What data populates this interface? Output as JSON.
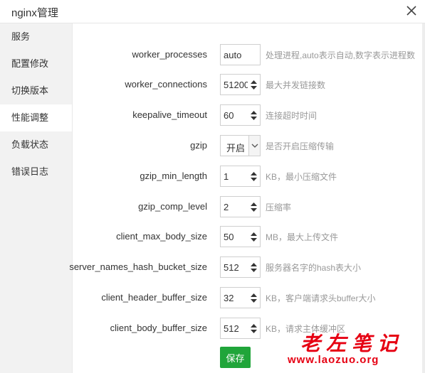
{
  "window": {
    "title": "nginx管理",
    "close_icon": "close-icon"
  },
  "sidebar": {
    "items": [
      {
        "label": "服务"
      },
      {
        "label": "配置修改"
      },
      {
        "label": "切换版本"
      },
      {
        "label": "性能调整",
        "active": true
      },
      {
        "label": "负载状态"
      },
      {
        "label": "错误日志"
      }
    ]
  },
  "settings": [
    {
      "name": "worker_processes",
      "value": "auto",
      "type": "text",
      "hint": "处理进程,auto表示自动,数字表示进程数"
    },
    {
      "name": "worker_connections",
      "value": "51200",
      "type": "number",
      "hint": "最大并发链接数"
    },
    {
      "name": "keepalive_timeout",
      "value": "60",
      "type": "number",
      "hint": "连接超时时间"
    },
    {
      "name": "gzip",
      "value": "开启",
      "type": "select",
      "hint": "是否开启压缩传输"
    },
    {
      "name": "gzip_min_length",
      "value": "1",
      "type": "number",
      "hint": "KB，最小压缩文件"
    },
    {
      "name": "gzip_comp_level",
      "value": "2",
      "type": "number",
      "hint": "压缩率"
    },
    {
      "name": "client_max_body_size",
      "value": "50",
      "type": "number",
      "hint": "MB，最大上传文件"
    },
    {
      "name": "server_names_hash_bucket_size",
      "value": "512",
      "type": "number",
      "hint": "服务器名字的hash表大小"
    },
    {
      "name": "client_header_buffer_size",
      "value": "32",
      "type": "number",
      "hint": "KB，客户端请求头buffer大小"
    },
    {
      "name": "client_body_buffer_size",
      "value": "512",
      "type": "number",
      "hint": "KB，请求主体缓冲区"
    }
  ],
  "actions": {
    "save_label": "保存"
  },
  "watermark": {
    "text": "老左笔记",
    "url": "www.laozuo.org"
  },
  "colors": {
    "accent": "#20a53a",
    "watermark": "#e60012",
    "sidebar_bg": "#f2f2f2",
    "hint": "#999999"
  }
}
